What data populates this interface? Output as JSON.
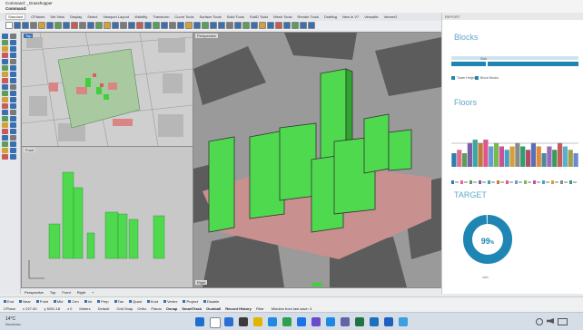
{
  "command": {
    "line1": "Command: _Grasshopper",
    "line2": "Command:"
  },
  "tabs": [
    "Standard",
    "CPlanes",
    "Set View",
    "Display",
    "Select",
    "Viewport Layout",
    "Visibility",
    "Transform",
    "Curve Tools",
    "Surface Tools",
    "Solid Tools",
    "SubD Tools",
    "Mesh Tools",
    "Render Tools",
    "Drafting",
    "New in V7",
    "Versatile",
    "Veneer2"
  ],
  "viewports": {
    "top": "Top",
    "front": "Front",
    "perspective": "Perspective",
    "right": "Right"
  },
  "viewport_tabs": [
    "Perspective",
    "Top",
    "Front",
    "Right",
    "+"
  ],
  "snaps": [
    "End",
    "Near",
    "Point",
    "Mid",
    "Cen",
    "Int",
    "Perp",
    "Tan",
    "Quad",
    "Knot",
    "Vertex",
    "Project",
    "Disable"
  ],
  "status": {
    "cplane": "CPlane",
    "x": "x 227.00",
    "y": "y 5291.18",
    "z": "z 0",
    "units": "Meters",
    "layer": "Default",
    "items": [
      "Grid Snap",
      "Ortho",
      "Planar",
      "Osnap",
      "SmartTrack",
      "Gumball",
      "Record History",
      "Filter"
    ],
    "bold_items": [
      "Osnap",
      "SmartTrack",
      "Gumball",
      "Record History"
    ],
    "message": "Minutes from last save: 4"
  },
  "panel": {
    "header": "REPORT",
    "blocks_title": "Blocks",
    "blocks_bar_label": "Slab",
    "floors_title": "Floors",
    "target_title": "TARGET",
    "target_value": 99,
    "target_value_label": "99",
    "target_unit": "%",
    "target_caption": "ratio",
    "legend": [
      "Tower Height",
      "Block Blocks"
    ],
    "colors": {
      "accent": "#1f86b3",
      "title": "#5ea8c8"
    }
  },
  "floors_chart": {
    "values": [
      4,
      5,
      4,
      7,
      8,
      7,
      8,
      6,
      7,
      6,
      5,
      6,
      7,
      6,
      5,
      7,
      6,
      4,
      6,
      5,
      7,
      6,
      5,
      4
    ],
    "colors": [
      "#2a7fb0",
      "#e06c8a",
      "#5a9e5a",
      "#7b5ea8",
      "#3aa8a0",
      "#c07a3a",
      "#e0578e",
      "#5f9fd4",
      "#7cb84a",
      "#c9509a",
      "#4aa0c0",
      "#d4a03a",
      "#8a8a8a",
      "#2f9e6e",
      "#b44a6a",
      "#5a6fb8",
      "#e08a3a",
      "#4a8a9a",
      "#9a6abf",
      "#3a9a5a",
      "#c85a5a",
      "#5ab0d0",
      "#a0a04a",
      "#6a8ad0"
    ]
  },
  "taskbar": {
    "weather_temp": "14°C",
    "weather_text": "Nuvoloso"
  }
}
